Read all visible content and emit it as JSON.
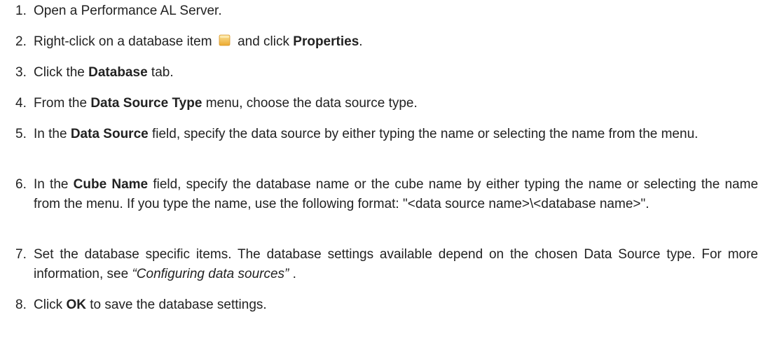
{
  "steps": [
    {
      "num": "1.",
      "text": "Open a Performance AL Server."
    },
    {
      "num": "2.",
      "pre": "Right-click on a database item",
      "icon": "database-item-icon",
      "mid": "and click",
      "bold": "Properties",
      "post": "."
    },
    {
      "num": "3.",
      "pre": "Click the",
      "bold": "Database",
      "post": "tab."
    },
    {
      "num": "4.",
      "pre": "From the",
      "bold": "Data Source Type",
      "post": "menu, choose the data source type."
    },
    {
      "num": "5.",
      "pre": "In the",
      "bold": "Data Source",
      "post": "field, specify the data source by either typing the name or selecting the name from the menu."
    },
    {
      "num": "6.",
      "pre": "In the",
      "bold": "Cube Name",
      "post": "field, specify the database name or the cube name by either typing the name or selecting the name from the menu. If you type the name, use the following format: \"<data source name>\\<database name>\"."
    },
    {
      "num": "7.",
      "pre": "Set the database specific items. The database settings available depend on the chosen Data Source type. For more information, see",
      "italic": "“Configuring data sources”",
      "post": "."
    },
    {
      "num": "8.",
      "pre": "Click",
      "bold": "OK",
      "post": "to save the database settings."
    }
  ],
  "icon_colors": {
    "database_item_top": "#f7d77a",
    "database_item_body": "#f0b63a"
  }
}
